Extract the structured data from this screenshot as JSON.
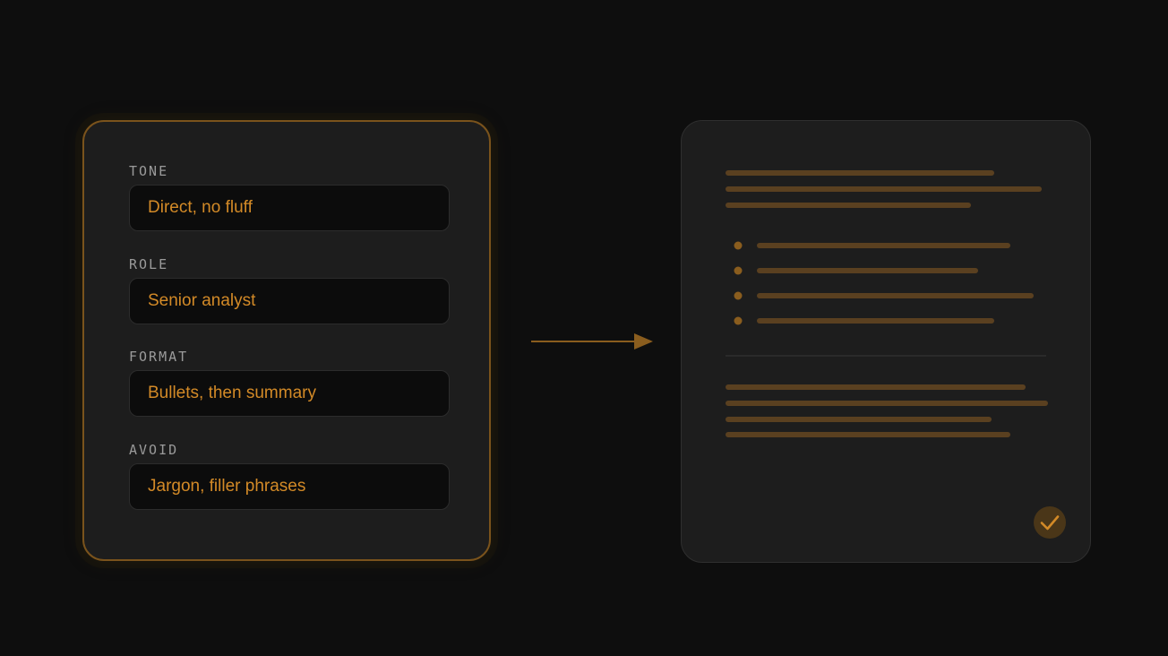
{
  "config": {
    "fields": [
      {
        "label": "TONE",
        "value": "Direct, no fluff"
      },
      {
        "label": "ROLE",
        "value": "Senior analyst"
      },
      {
        "label": "FORMAT",
        "value": "Bullets, then summary"
      },
      {
        "label": "AVOID",
        "value": "Jargon, filler phrases"
      }
    ]
  },
  "colors": {
    "background": "#0e0e0e",
    "card": "#1d1d1d",
    "accent": "#d38a27",
    "accent_border": "#7a531c",
    "placeholder_line": "#5a4020",
    "bullet": "#8a5d1e"
  },
  "icons": {
    "arrow": "arrow-right-icon",
    "check": "check-icon"
  }
}
